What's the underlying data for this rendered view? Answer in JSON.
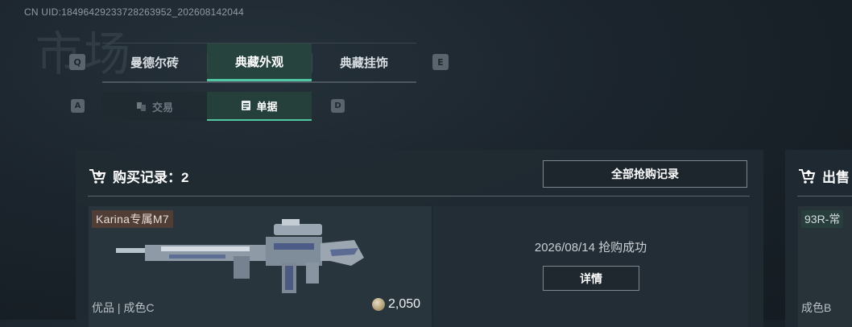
{
  "uid_text": "CN UID:18496429233728263952_202608142044",
  "bg_title": "市场",
  "keys": {
    "prev_tab": "Q",
    "next_tab": "E",
    "prev_subtab": "A",
    "next_subtab": "D"
  },
  "tabs": [
    {
      "label": "曼德尔砖",
      "active": false
    },
    {
      "label": "典藏外观",
      "active": true
    },
    {
      "label": "典藏挂饰",
      "active": false
    }
  ],
  "subtabs": [
    {
      "label": "交易",
      "icon": "trade-icon",
      "active": false
    },
    {
      "label": "单据",
      "icon": "receipt-icon",
      "active": true
    }
  ],
  "purchase": {
    "title": "购买记录：2",
    "all_button": "全部抢购记录",
    "item_name": "Karina专属M7",
    "quality": "优品 | 成色C",
    "price": "2,050",
    "status": "2026/08/14 抢购成功",
    "detail_button": "详情"
  },
  "sale": {
    "title": "出售",
    "item_name": "93R-常",
    "quality": "成色B"
  },
  "colors": {
    "accent": "#4fc7a3",
    "background": "#1b242c",
    "name_tag": "#4f3d36"
  }
}
